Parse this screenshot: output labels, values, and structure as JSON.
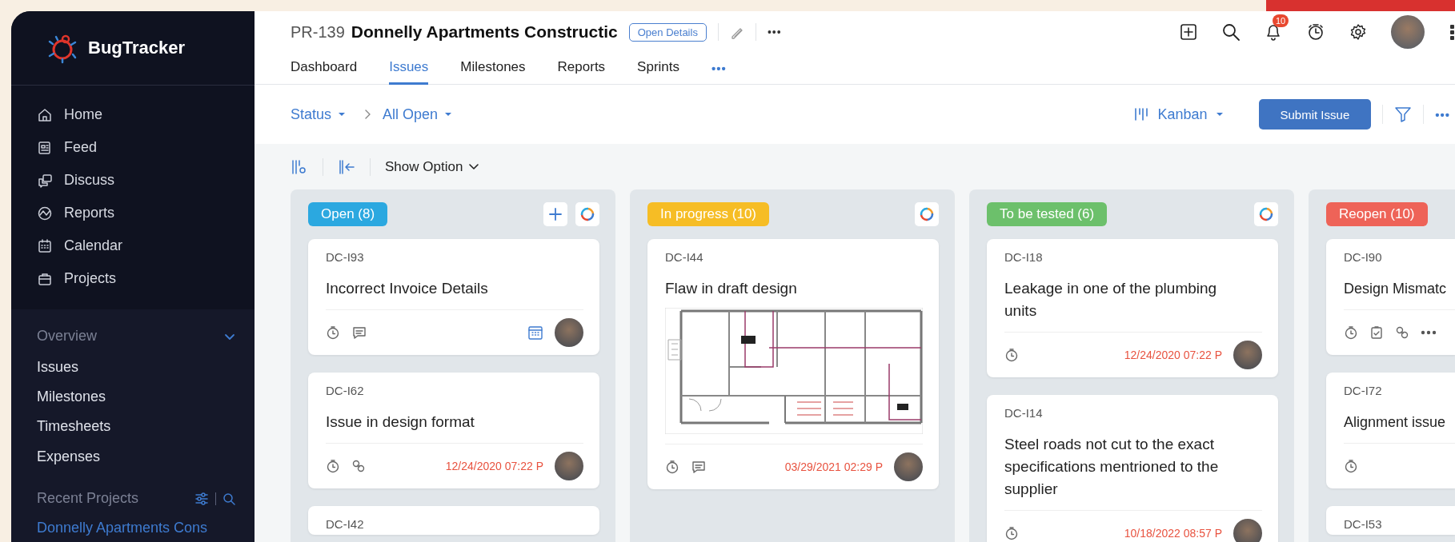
{
  "sidebar": {
    "app_name": "BugTracker",
    "nav": [
      {
        "label": "Home"
      },
      {
        "label": "Feed"
      },
      {
        "label": "Discuss"
      },
      {
        "label": "Reports"
      },
      {
        "label": "Calendar"
      },
      {
        "label": "Projects"
      }
    ],
    "overview": {
      "title": "Overview",
      "expanded": true,
      "items": [
        {
          "label": "Issues"
        },
        {
          "label": "Milestones"
        },
        {
          "label": "Timesheets"
        },
        {
          "label": "Expenses"
        }
      ]
    },
    "recent_projects": {
      "title": "Recent Projects",
      "items": [
        {
          "label": "Donnelly Apartments Cons"
        }
      ]
    }
  },
  "header": {
    "project_id": "PR-139",
    "project_name": "Donnelly Apartments Constructic",
    "details_button": "Open Details",
    "more": "•••",
    "tabs": [
      {
        "label": "Dashboard",
        "selected": false
      },
      {
        "label": "Issues",
        "selected": true
      },
      {
        "label": "Milestones",
        "selected": false
      },
      {
        "label": "Reports",
        "selected": false
      },
      {
        "label": "Sprints",
        "selected": false
      }
    ],
    "tabs_more": "•••",
    "notification_count": "10"
  },
  "toolbar": {
    "filters": [
      {
        "label": "Status"
      },
      {
        "label": "All Open"
      }
    ],
    "view": "Kanban",
    "submit_button": "Submit Issue",
    "more": "•••"
  },
  "board": {
    "show_option": "Show Option",
    "columns": [
      {
        "status": "Open (8)",
        "color": "#2ba8e0",
        "actions": [
          {
            "kind": "add"
          },
          {
            "kind": "ring"
          }
        ],
        "cards": [
          {
            "id": "DC-I93",
            "title": "Incorrect Invoice Details",
            "indicators": [
              {
                "kind": "timer"
              },
              {
                "kind": "comment"
              }
            ],
            "calendar": true,
            "avatar": true
          },
          {
            "id": "DC-I62",
            "title": "Issue in design format",
            "indicators": [
              {
                "kind": "timer"
              },
              {
                "kind": "link"
              }
            ],
            "due": "12/24/2020 07:22 P",
            "avatar": true
          },
          {
            "id": "DC-I42"
          }
        ]
      },
      {
        "status": "In progress (10)",
        "color": "#f6bd25",
        "actions": [
          {
            "kind": "ring"
          }
        ],
        "cards": [
          {
            "id": "DC-I44",
            "title": "Flaw in draft design",
            "image": true,
            "indicators": [
              {
                "kind": "timer"
              },
              {
                "kind": "comment"
              }
            ],
            "due": "03/29/2021 02:29 P",
            "avatar": true
          }
        ]
      },
      {
        "status": "To be tested (6)",
        "color": "#6cc06b",
        "actions": [
          {
            "kind": "ring"
          }
        ],
        "cards": [
          {
            "id": "DC-I18",
            "title": "Leakage in one of the plumbing units",
            "indicators": [
              {
                "kind": "timer"
              }
            ],
            "due": "12/24/2020 07:22 P",
            "avatar": true
          },
          {
            "id": "DC-I14",
            "title": "Steel roads not cut to the exact specifications mentrioned to the supplier",
            "indicators": [
              {
                "kind": "timer"
              }
            ],
            "due": "10/18/2022 08:57 P",
            "avatar": true
          }
        ]
      },
      {
        "status": "Reopen (10)",
        "color": "#ee6358",
        "cards": [
          {
            "id": "DC-I90",
            "title": "Design Mismatc",
            "indicators": [
              {
                "kind": "timer"
              },
              {
                "kind": "checklist"
              },
              {
                "kind": "link"
              },
              {
                "kind": "more"
              }
            ]
          },
          {
            "id": "DC-I72",
            "title": "Alignment issue",
            "indicators": [
              {
                "kind": "timer"
              }
            ]
          },
          {
            "id": "DC-I53"
          }
        ]
      }
    ]
  }
}
